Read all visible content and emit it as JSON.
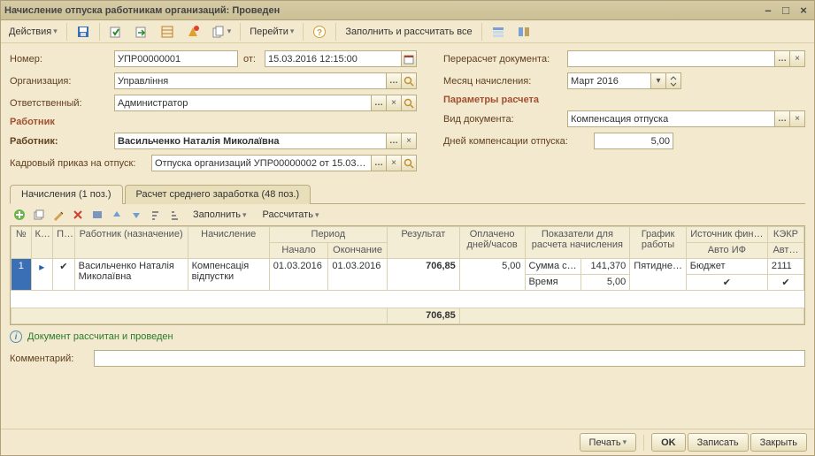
{
  "window": {
    "title": "Начисление отпуска работникам организаций: Проведен"
  },
  "toolbar": {
    "actions": "Действия",
    "goto": "Перейти",
    "fill": "Заполнить и рассчитать все"
  },
  "form": {
    "number_lbl": "Номер:",
    "number": "УПР00000001",
    "from_lbl": "от:",
    "date": "15.03.2016 12:15:00",
    "org_lbl": "Организация:",
    "org": "Управління",
    "resp_lbl": "Ответственный:",
    "resp": "Администратор",
    "employee_section": "Работник",
    "emp_lbl": "Работник:",
    "emp": "Васильченко Наталія Миколаївна",
    "order_lbl": "Кадровый приказ на отпуск:",
    "order": "Отпуска организаций УПР00000002 от 15.03…",
    "recalc_lbl": "Перерасчет документа:",
    "recalc": "",
    "month_lbl": "Месяц начисления:",
    "month": "Март 2016",
    "params_section": "Параметры расчета",
    "doctype_lbl": "Вид документа:",
    "doctype": "Компенсация отпуска",
    "days_lbl": "Дней компенсации отпуска:",
    "days": "5,00"
  },
  "tabs": {
    "t1": "Начисления (1 поз.)",
    "t2": "Расчет среднего заработка (48 поз.)"
  },
  "gridtoolbar": {
    "fill": "Заполнить",
    "calc": "Рассчитать"
  },
  "grid": {
    "headers": {
      "no": "№",
      "k": "К…",
      "p": "П… а…",
      "worker": "Работник (назначение)",
      "accrual": "Начисление",
      "period": "Период",
      "start": "Начало",
      "end": "Окончание",
      "result": "Результат",
      "paid": "Оплачено дней/часов",
      "indicators": "Показатели для расчета начисления",
      "schedule": "График работы",
      "fin": "Источник фин…",
      "autoif": "Авто ИФ",
      "kekr": "КЭКР",
      "avt": "Авт…"
    },
    "rows": [
      {
        "idx": "1",
        "worker": "Васильченко Наталія Миколаївна",
        "accrual": "Компенсація відпустки",
        "start": "01.03.2016",
        "end": "01.03.2016",
        "result": "706,85",
        "paid": "5,00",
        "ind_name1": "Сумма с…",
        "ind_val1": "141,370",
        "ind_name2": "Время",
        "ind_val2": "5,00",
        "schedule": "Пятидне…",
        "fin": "Бюджет",
        "kekr": "2111"
      }
    ],
    "total_result": "706,85"
  },
  "info": "Документ рассчитан и проведен",
  "comment_lbl": "Комментарий:",
  "comment": "",
  "footer": {
    "print": "Печать",
    "ok": "OK",
    "save": "Записать",
    "close": "Закрыть"
  }
}
